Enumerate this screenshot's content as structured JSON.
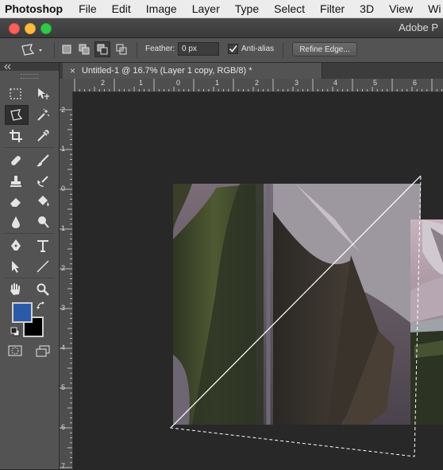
{
  "menubar": {
    "app": "Photoshop",
    "items": [
      "File",
      "Edit",
      "Image",
      "Layer",
      "Type",
      "Select",
      "Filter",
      "3D",
      "View",
      "Wi"
    ]
  },
  "titlebar": {
    "title": "Adobe P"
  },
  "options": {
    "feather_label": "Feather:",
    "feather_value": "0 px",
    "antialias_label": "Anti-alias",
    "antialias_checked": true,
    "refine_label": "Refine Edge..."
  },
  "document": {
    "close_glyph": "×",
    "tab_title": "Untitled-1 @ 16.7% (Layer 1 copy, RGB/8) *"
  },
  "rulers": {
    "horizontal": [
      "2",
      "1",
      "0",
      "1",
      "2",
      "3",
      "4",
      "5",
      "6"
    ],
    "vertical": [
      "2",
      "1",
      "0",
      "1",
      "2",
      "3",
      "4",
      "5",
      "6",
      "7"
    ]
  },
  "tools": {
    "icons": [
      "marquee-icon",
      "move-icon",
      "polygonal-lasso-icon",
      "magic-wand-icon",
      "crop-icon",
      "eyedropper-icon",
      "healing-brush-icon",
      "brush-icon",
      "clone-stamp-icon",
      "history-brush-icon",
      "eraser-icon",
      "paint-bucket-icon",
      "blur-icon",
      "dodge-icon",
      "pen-icon",
      "type-icon",
      "path-selection-icon",
      "line-icon",
      "hand-icon",
      "zoom-icon"
    ]
  },
  "colors": {
    "foreground": "#2a5aa8",
    "background": "#000000",
    "menubar": "#ececec",
    "panel": "#535353",
    "canvas": "#282828"
  }
}
